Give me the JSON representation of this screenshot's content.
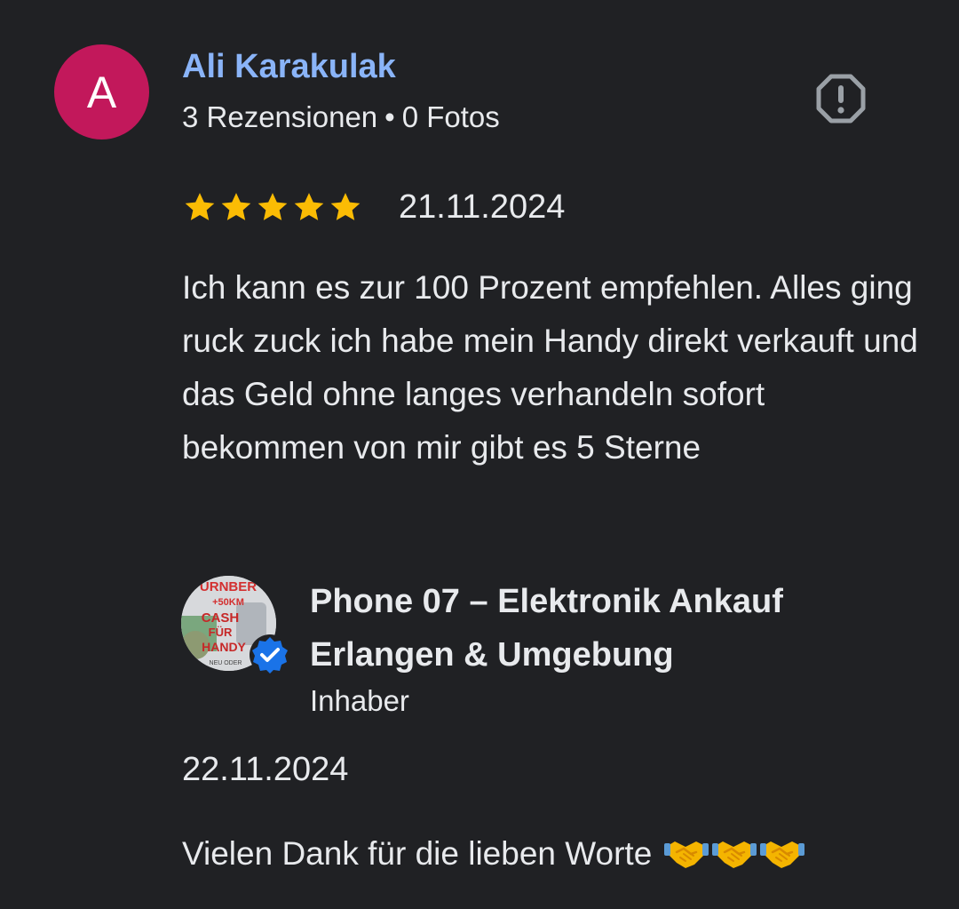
{
  "reviewer": {
    "initial": "A",
    "avatar_color": "#c2185b",
    "name": "Ali Karakulak",
    "name_color": "#8ab4f8",
    "reviews_count": "3 Rezensionen",
    "separator": "•",
    "photos_count": "0 Fotos"
  },
  "report_icon": "report-flag-icon",
  "review": {
    "rating": 5,
    "max_rating": 5,
    "star_color": "#fbbc04",
    "date": "21.11.2024",
    "text": "Ich kann es zur 100 Prozent empfehlen. Alles ging ruck zuck ich habe mein Handy direkt verkauft und das Geld ohne langes verhandeln sofort bekommen von mir gibt es 5 Sterne"
  },
  "owner_reply": {
    "avatar_logo_lines": [
      "ÜRNBER",
      "+50KM",
      "CASH",
      "FÜR",
      "HANDY",
      "NEU ODER"
    ],
    "verified_icon": "verified-badge-icon",
    "verified_color": "#1a73e8",
    "business_name": "Phone 07 – Elektronik Ankauf Erlangen & Umgebung",
    "role": "Inhaber",
    "date": "22.11.2024",
    "text": "Vielen Dank für die lieben Worte",
    "emoji": [
      "handshake-emoji",
      "handshake-emoji",
      "handshake-emoji"
    ]
  },
  "background_color": "#202124"
}
